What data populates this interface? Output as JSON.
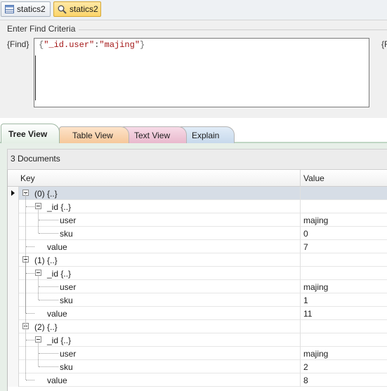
{
  "doc_tabs": [
    {
      "label": "statics2",
      "icon": "table-icon",
      "active": false
    },
    {
      "label": "statics2",
      "icon": "search-icon",
      "active": true
    }
  ],
  "criteria": {
    "title": "Enter Find Criteria",
    "find_label": "{Find}",
    "find_label_right": "{F",
    "query": {
      "open": "{",
      "key": "\"_id.user\"",
      "colon": ":",
      "value": "\"majing\"",
      "close": "}"
    }
  },
  "result_tabs": [
    "Tree View",
    "Table View",
    "Text View",
    "Explain"
  ],
  "document_count": "3 Documents",
  "grid": {
    "headers": {
      "key": "Key",
      "value": "Value"
    },
    "rows": [
      {
        "key": "(0) {..}",
        "value": ""
      },
      {
        "key": "_id {..}",
        "value": ""
      },
      {
        "key": "user",
        "value": "majing"
      },
      {
        "key": "sku",
        "value": "0"
      },
      {
        "key": "value",
        "value": "7"
      },
      {
        "key": "(1) {..}",
        "value": ""
      },
      {
        "key": "_id {..}",
        "value": ""
      },
      {
        "key": "user",
        "value": "majing"
      },
      {
        "key": "sku",
        "value": "1"
      },
      {
        "key": "value",
        "value": "11"
      },
      {
        "key": "(2) {..}",
        "value": ""
      },
      {
        "key": "_id {..}",
        "value": ""
      },
      {
        "key": "user",
        "value": "majing"
      },
      {
        "key": "sku",
        "value": "2"
      },
      {
        "key": "value",
        "value": "8"
      }
    ]
  },
  "colors": {
    "active_tab": "#fbd56a",
    "selected_row": "#d6dde6",
    "string_literal": "#a31515"
  }
}
